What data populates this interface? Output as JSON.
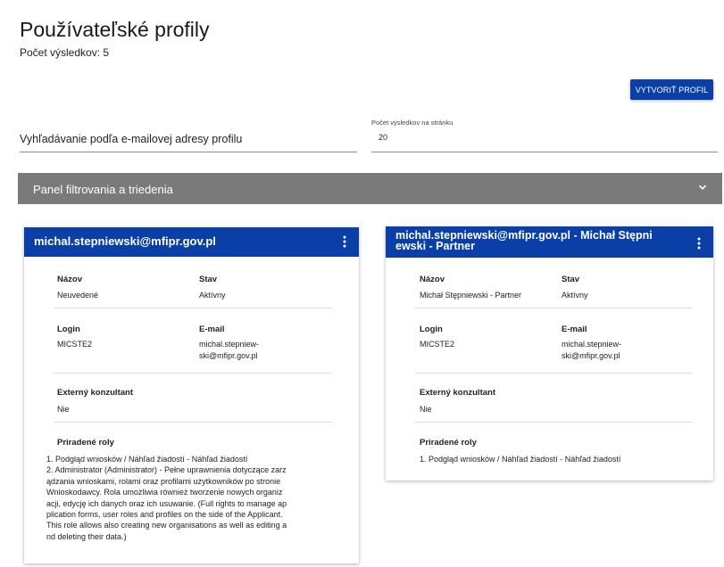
{
  "page": {
    "title": "Používateľské profily",
    "result_count": "Počet výsledkov: 5",
    "create_button": "VYTVORIŤ PROFIL"
  },
  "search": {
    "placeholder": "Vyhľadávanie podľa e-mailovej adresy profilu"
  },
  "per_page": {
    "label": "Počet výsledkov na stránku",
    "value": "20"
  },
  "filter_panel": {
    "label": "Panel filtrovania a triedenia"
  },
  "field_labels": {
    "name": "Názov",
    "status": "Stav",
    "login": "Login",
    "email": "E-mail",
    "external": "Externý konzultant",
    "roles": "Priradené roly"
  },
  "profiles": [
    {
      "title": "michal.stepniewski@mfipr.gov.pl",
      "name": "Neuvedené",
      "status": "Aktívny",
      "login": "MICSTE2",
      "email_line1": "michal.stepniew-",
      "email_line2": "ski@mfipr.gov.pl",
      "external": "Nie",
      "roles": [
        "1. Podgląd wniosków / Náhľad žiadostí - Náhľad žiadostí",
        "2. Administrator (Administrator) - Pełne uprawnienia dotyczące zarz",
        "ądzania wnioskami, rolami oraz profilami użytkowników po stronie",
        "Wnioskodawcy. Rola umożliwia również tworzenie nowych organiz",
        "acji, edycję ich danych oraz ich usuwanie. (Full rights to manage ap",
        "plication forms, user roles and profiles on the side of the Applicant.",
        "This role allows also creating new organisations as well as editing a",
        "nd deleting their data.)"
      ]
    },
    {
      "title_line1": "michal.stepniewski@mfipr.gov.pl - Michał Stępni",
      "title_line2": "ewski - Partner",
      "name": "Michał Stępniewski - Partner",
      "status": "Aktívny",
      "login": "MICSTE2",
      "email_line1": "michal.stepniew-",
      "email_line2": "ski@mfipr.gov.pl",
      "external": "Nie",
      "roles": [
        "1. Podgląd wniosków / Náhľad žiadostí - Náhľad žiadostí"
      ]
    }
  ],
  "icons": {
    "menu": "more-vert-icon",
    "chevron": "chevron-down-icon"
  },
  "colors": {
    "primary": "#0b3fa8",
    "panel": "#7a7a7a"
  }
}
